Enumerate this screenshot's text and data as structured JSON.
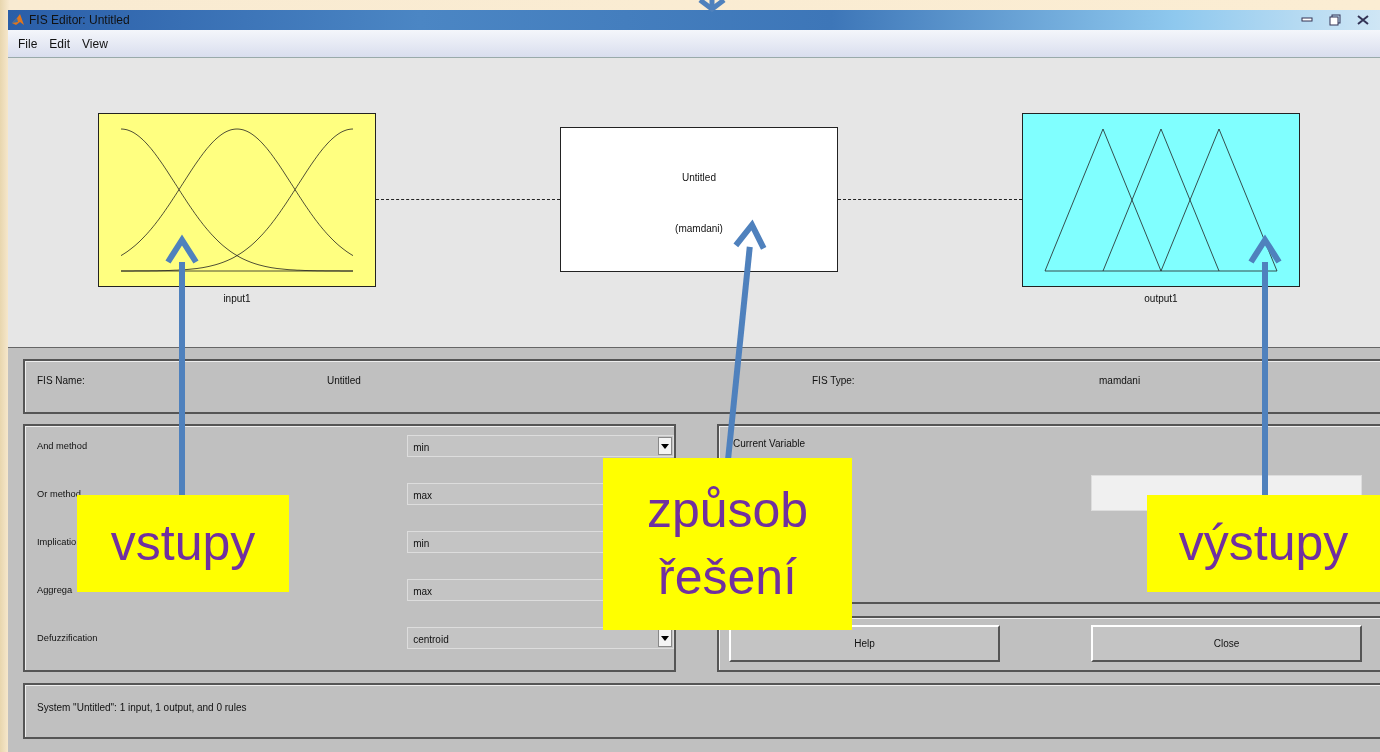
{
  "window": {
    "title": "FIS Editor: Untitled"
  },
  "menu": [
    "File",
    "Edit",
    "View"
  ],
  "diagram": {
    "input": {
      "label": "input1"
    },
    "system": {
      "name": "Untitled",
      "type": "(mamdani)"
    },
    "output": {
      "label": "output1"
    }
  },
  "fis": {
    "name_label": "FIS Name:",
    "name": "Untitled",
    "type_label": "FIS Type:",
    "type": "mamdani"
  },
  "methods": [
    {
      "label": "And method",
      "value": "min"
    },
    {
      "label": "Or method",
      "value": "max"
    },
    {
      "label": "Implicatio",
      "value": "min"
    },
    {
      "label": "Aggrega",
      "value": "max"
    },
    {
      "label": "Defuzzification",
      "value": "centroid"
    }
  ],
  "current_variable": {
    "label": "Current Variable"
  },
  "buttons": [
    "Help",
    "Close"
  ],
  "status": "System \"Untitled\": 1 input, 1 output, and 0 rules",
  "callouts": [
    {
      "text": "vstupy"
    },
    {
      "text": "způsob řešení"
    },
    {
      "text": "výstupy"
    }
  ]
}
